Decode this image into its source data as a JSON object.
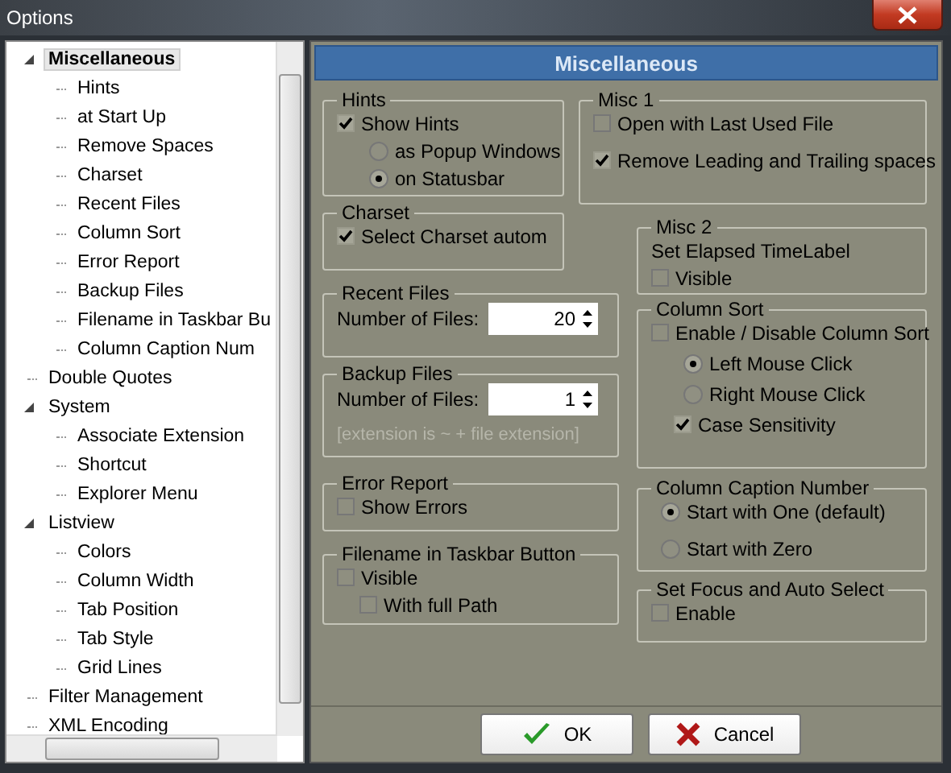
{
  "window": {
    "title": "Options"
  },
  "tree": [
    {
      "label": "Miscellaneous",
      "selected": true,
      "expanded": true,
      "children": [
        {
          "label": "Hints",
          "selected": false
        },
        {
          "label": "at Start Up",
          "selected": false
        },
        {
          "label": "Remove Spaces",
          "selected": false
        },
        {
          "label": "Charset",
          "selected": false
        },
        {
          "label": "Recent Files",
          "selected": false
        },
        {
          "label": "Column Sort",
          "selected": false
        },
        {
          "label": "Error Report",
          "selected": false
        },
        {
          "label": "Backup Files",
          "selected": false
        },
        {
          "label": "Filename in Taskbar Bu",
          "selected": false
        },
        {
          "label": "Column Caption Num",
          "selected": false
        }
      ]
    },
    {
      "label": "Double Quotes",
      "selected": false
    },
    {
      "label": "System",
      "selected": false,
      "expanded": true,
      "children": [
        {
          "label": "Associate Extension",
          "selected": false
        },
        {
          "label": "Shortcut",
          "selected": false
        },
        {
          "label": "Explorer Menu",
          "selected": false
        }
      ]
    },
    {
      "label": "Listview",
      "selected": false,
      "expanded": true,
      "children": [
        {
          "label": "Colors",
          "selected": false
        },
        {
          "label": "Column Width",
          "selected": false
        },
        {
          "label": "Tab Position",
          "selected": false
        },
        {
          "label": "Tab Style",
          "selected": false
        },
        {
          "label": "Grid Lines",
          "selected": false
        }
      ]
    },
    {
      "label": "Filter Management",
      "selected": false
    },
    {
      "label": "XML Encoding",
      "selected": false
    }
  ],
  "panel": {
    "title": "Miscellaneous",
    "left_groups": [
      {
        "title": "Hints",
        "controls": [
          {
            "kind": "checkbox",
            "label": "Show Hints",
            "checked": true,
            "children": [
              {
                "kind": "radio",
                "label": "as Popup Windows",
                "selected": false
              },
              {
                "kind": "radio",
                "label": "on Statusbar",
                "selected": true
              }
            ]
          }
        ]
      },
      {
        "title": "Charset",
        "controls": [
          {
            "kind": "checkbox",
            "label": "Select Charset autom",
            "checked": true
          }
        ]
      },
      {
        "title": "Recent Files",
        "controls": [
          {
            "kind": "spinner",
            "label": "Number of Files:",
            "value": "20"
          }
        ]
      },
      {
        "title": "Backup Files",
        "controls": [
          {
            "kind": "spinner",
            "label": "Number of Files:",
            "value": "1"
          },
          {
            "kind": "note",
            "label": "[extension is ~ + file extension]"
          }
        ]
      },
      {
        "title": "Error Report",
        "controls": [
          {
            "kind": "checkbox",
            "label": "Show Errors",
            "checked": false
          }
        ]
      },
      {
        "title": "Filename in Taskbar Button",
        "controls": [
          {
            "kind": "checkbox",
            "label": "Visible",
            "checked": false,
            "children": [
              {
                "kind": "checkbox",
                "label": "With full Path",
                "checked": false
              }
            ]
          }
        ]
      }
    ],
    "right_groups": [
      {
        "title": "Misc 1",
        "controls": [
          {
            "kind": "checkbox",
            "label": "Open with Last Used File",
            "checked": false
          },
          {
            "kind": "checkbox",
            "label": "Remove Leading and Trailing spaces",
            "checked": true
          }
        ]
      },
      {
        "title": "Misc 2",
        "controls": [
          {
            "kind": "text",
            "label": "Set Elapsed TimeLabel"
          },
          {
            "kind": "checkbox",
            "label": "Visible",
            "checked": false
          }
        ]
      },
      {
        "title": "Column Sort",
        "controls": [
          {
            "kind": "checkbox",
            "label": "Enable / Disable Column Sort",
            "checked": false,
            "children": [
              {
                "kind": "radio",
                "label": "Left Mouse Click",
                "selected": true
              },
              {
                "kind": "radio",
                "label": "Right Mouse Click",
                "selected": false
              },
              {
                "kind": "checkbox",
                "label": "Case Sensitivity",
                "checked": true
              }
            ]
          }
        ]
      },
      {
        "title": "Column Caption Number",
        "controls": [
          {
            "kind": "radio",
            "label": "Start with One (default)",
            "selected": true
          },
          {
            "kind": "radio",
            "label": "Start with Zero",
            "selected": false
          }
        ]
      },
      {
        "title": "Set Focus and Auto Select",
        "controls": [
          {
            "kind": "checkbox",
            "label": "Enable",
            "checked": false
          }
        ]
      }
    ]
  },
  "buttons": [
    {
      "label": "OK",
      "kind": "ok"
    },
    {
      "label": "Cancel",
      "kind": "cancel"
    }
  ]
}
